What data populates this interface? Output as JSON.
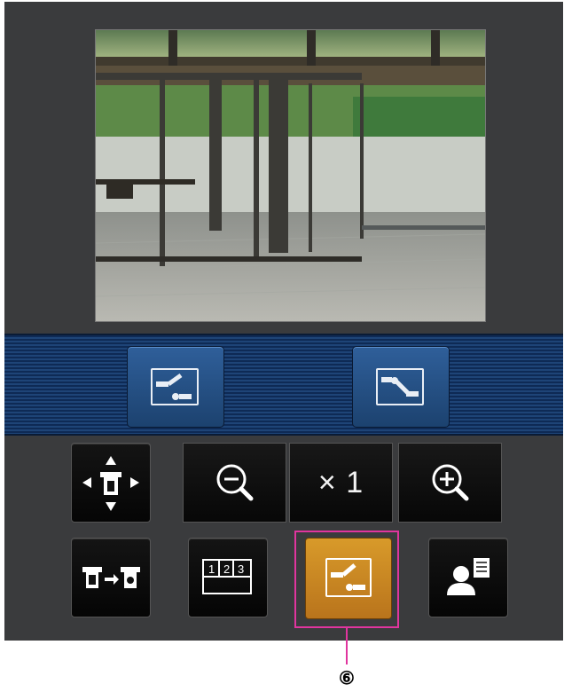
{
  "zoom": {
    "level_label": "× 1"
  },
  "callout": {
    "number": "⑥"
  },
  "icons": {
    "preset_position": "preset-camera-icon",
    "home_position": "home-position-icon",
    "pan_tilt": "pan-tilt-joystick-icon",
    "zoom_out": "zoom-out-icon",
    "zoom_in": "zoom-in-icon",
    "camera_switch": "camera-switch-icon",
    "multi_screen": "multi-screen-icon",
    "user": "user-list-icon"
  },
  "colors": {
    "active_button": "#c98522",
    "highlight": "#e0359e",
    "strip": "#1e4477"
  }
}
